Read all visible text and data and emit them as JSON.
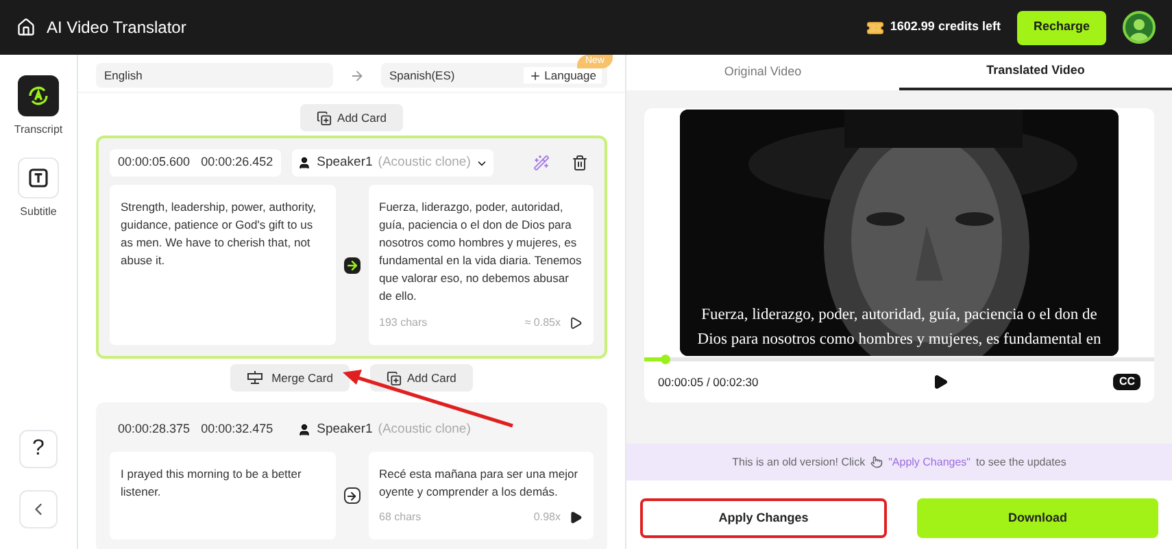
{
  "header": {
    "title": "AI Video Translator",
    "credits": "1602.99 credits left",
    "recharge": "Recharge"
  },
  "sidebar": {
    "items": [
      {
        "kind": "transcript",
        "label": "Transcript",
        "selected": true
      },
      {
        "kind": "subtitle",
        "label": "Subtitle",
        "selected": false
      }
    ],
    "help": "?"
  },
  "languages": {
    "source": "English",
    "target": "Spanish(ES)",
    "add_language": "Language",
    "badge": "New"
  },
  "add_card": "Add Card",
  "cards": [
    {
      "start": "00:00:05.600",
      "end": "00:00:26.452",
      "speaker": "Speaker1",
      "voice": "(Acoustic clone)",
      "selected": true,
      "source_text": "Strength, leadership, power, authority, guidance, patience or God's gift to us as men. We have to cherish that, not abuse it.",
      "translated_text": "Fuerza, liderazgo, poder, autoridad, guía, paciencia o el don de Dios para nosotros como hombres y mujeres, es fundamental en la vida diaria. Tenemos que valorar eso, no debemos abusar de ello.",
      "chars": "193 chars",
      "speed": "≈ 0.85x"
    },
    {
      "start": "00:00:28.375",
      "end": "00:00:32.475",
      "speaker": "Speaker1",
      "voice": "(Acoustic clone)",
      "selected": false,
      "source_text": "I prayed this morning to be a better listener.",
      "translated_text": "Recé esta mañana para ser una mejor oyente y comprender a los demás.",
      "chars": "68 chars",
      "speed": "0.98x"
    }
  ],
  "between_actions": {
    "merge": "Merge Card",
    "add": "Add Card"
  },
  "tabs": [
    {
      "label": "Original Video",
      "selected": false
    },
    {
      "label": "Translated Video",
      "selected": true
    }
  ],
  "player": {
    "caption": "Fuerza, liderazgo, poder, autoridad, guía, paciencia o el don de Dios para nosotros como hombres y mujeres, es fundamental en",
    "level": 0.04,
    "time": "00:00:05 / 00:02:30",
    "cc": "CC"
  },
  "notice": {
    "before": "This is an old version! Click",
    "link": "\"Apply Changes\"",
    "after": "to see the updates"
  },
  "actions": [
    {
      "kind": "apply",
      "label": "Apply Changes",
      "annotated": true
    },
    {
      "kind": "download",
      "label": "Download",
      "annotated": false
    }
  ]
}
